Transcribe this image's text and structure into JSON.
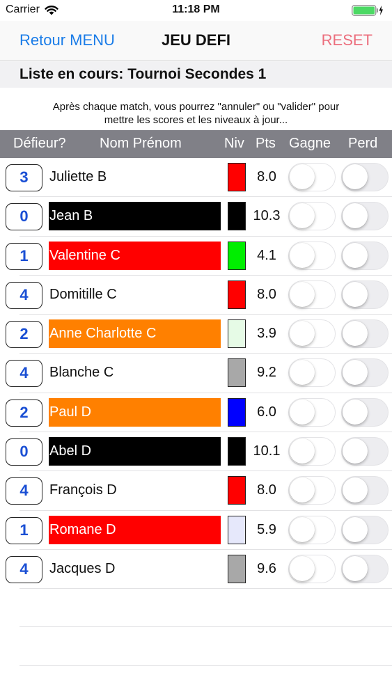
{
  "status": {
    "carrier": "Carrier",
    "time": "11:18 PM",
    "wifi_icon": "wifi-icon",
    "battery_icon": "battery-charging-icon",
    "battery_color": "#4cd964"
  },
  "nav": {
    "back_label": "Retour MENU",
    "title": "JEU  DEFI",
    "reset_label": "RESET",
    "back_color": "#1a7ce8",
    "reset_color": "#ec6e7d"
  },
  "list_title": "Liste en cours: Tournoi Secondes 1",
  "instructions": {
    "line1": "Après chaque match, vous pourrez \"annuler\" ou \"valider\" pour",
    "line2": "mettre les scores et les niveaux à jour..."
  },
  "header": {
    "defier": "Défieur?",
    "name": "Nom Prénom",
    "level": "Niv",
    "points": "Pts",
    "win": "Gagne",
    "lose": "Perd"
  },
  "players": [
    {
      "defier": "3",
      "name": "Juliette B",
      "name_bg": "#ffffff",
      "name_color": "#111111",
      "level_color": "#ff0000",
      "points": "8.0",
      "win_on": false,
      "lose_on": false
    },
    {
      "defier": "0",
      "name": "Jean B",
      "name_bg": "#000000",
      "name_color": "#ffffff",
      "level_color": "#000000",
      "points": "10.3",
      "win_on": false,
      "lose_on": false
    },
    {
      "defier": "1",
      "name": "Valentine C",
      "name_bg": "#ff0000",
      "name_color": "#ffffff",
      "level_color": "#00ee00",
      "points": "4.1",
      "win_on": false,
      "lose_on": false
    },
    {
      "defier": "4",
      "name": "Domitille C",
      "name_bg": "#ffffff",
      "name_color": "#111111",
      "level_color": "#ff0000",
      "points": "8.0",
      "win_on": false,
      "lose_on": false
    },
    {
      "defier": "2",
      "name": "Anne Charlotte C",
      "name_bg": "#ff8000",
      "name_color": "#ffffff",
      "level_color": "#e6fbe6",
      "points": "3.9",
      "win_on": false,
      "lose_on": false
    },
    {
      "defier": "4",
      "name": "Blanche C",
      "name_bg": "#ffffff",
      "name_color": "#111111",
      "level_color": "#a8a8a8",
      "points": "9.2",
      "win_on": false,
      "lose_on": false
    },
    {
      "defier": "2",
      "name": "Paul D",
      "name_bg": "#ff8000",
      "name_color": "#ffffff",
      "level_color": "#0000ff",
      "points": "6.0",
      "win_on": false,
      "lose_on": false
    },
    {
      "defier": "0",
      "name": "Abel D",
      "name_bg": "#000000",
      "name_color": "#ffffff",
      "level_color": "#000000",
      "points": "10.1",
      "win_on": false,
      "lose_on": false
    },
    {
      "defier": "4",
      "name": "François D",
      "name_bg": "#ffffff",
      "name_color": "#111111",
      "level_color": "#ff0000",
      "points": "8.0",
      "win_on": false,
      "lose_on": false
    },
    {
      "defier": "1",
      "name": "Romane D",
      "name_bg": "#ff0000",
      "name_color": "#ffffff",
      "level_color": "#e6e8fb",
      "points": "5.9",
      "win_on": false,
      "lose_on": false
    },
    {
      "defier": "4",
      "name": "Jacques D",
      "name_bg": "#ffffff",
      "name_color": "#111111",
      "level_color": "#a8a8a8",
      "points": "9.6",
      "win_on": false,
      "lose_on": false
    }
  ]
}
